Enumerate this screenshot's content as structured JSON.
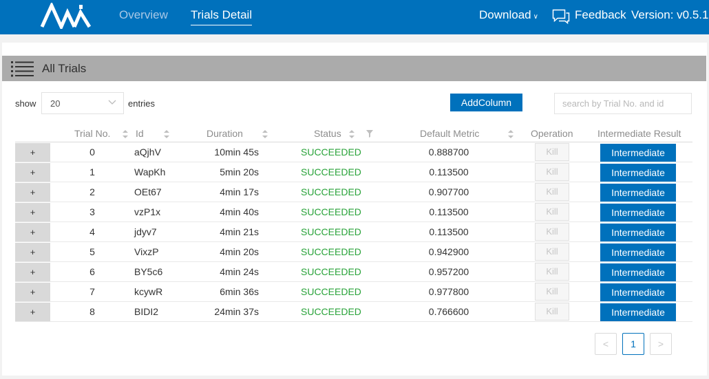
{
  "header": {
    "nav": {
      "overview": "Overview",
      "trials_detail": "Trials Detail"
    },
    "download": "Download",
    "download_caret": "∨",
    "feedback": "Feedback",
    "version": "Version: v0.5.1",
    "color": "#0071bc"
  },
  "panel": {
    "title": "All Trials",
    "show_label": "show",
    "page_size": "20",
    "entries_label": "entries",
    "add_column_label": "AddColumn",
    "search": {
      "placeholder": "search by Trial No. and id",
      "value": ""
    }
  },
  "table": {
    "columns": {
      "trial_no": "Trial No.",
      "id": "Id",
      "duration": "Duration",
      "status": "Status",
      "default_metric": "Default Metric",
      "operation": "Operation",
      "intermediate_result": "Intermediate Result"
    },
    "expand_label": "+",
    "kill_label": "Kill",
    "intermediate_label": "Intermediate",
    "status_color": "#2aa33a",
    "rows": [
      {
        "trial_no": "0",
        "id": "aQjhV",
        "duration": "10min 45s",
        "status": "SUCCEEDED",
        "metric": "0.888700"
      },
      {
        "trial_no": "1",
        "id": "WapKh",
        "duration": "5min 20s",
        "status": "SUCCEEDED",
        "metric": "0.113500"
      },
      {
        "trial_no": "2",
        "id": "OEt67",
        "duration": "4min 17s",
        "status": "SUCCEEDED",
        "metric": "0.907700"
      },
      {
        "trial_no": "3",
        "id": "vzP1x",
        "duration": "4min 40s",
        "status": "SUCCEEDED",
        "metric": "0.113500"
      },
      {
        "trial_no": "4",
        "id": "jdyv7",
        "duration": "4min 21s",
        "status": "SUCCEEDED",
        "metric": "0.113500"
      },
      {
        "trial_no": "5",
        "id": "VixzP",
        "duration": "4min 20s",
        "status": "SUCCEEDED",
        "metric": "0.942900"
      },
      {
        "trial_no": "6",
        "id": "BY5c6",
        "duration": "4min 24s",
        "status": "SUCCEEDED",
        "metric": "0.957200"
      },
      {
        "trial_no": "7",
        "id": "kcywR",
        "duration": "6min 36s",
        "status": "SUCCEEDED",
        "metric": "0.977800"
      },
      {
        "trial_no": "8",
        "id": "BIDI2",
        "duration": "24min 37s",
        "status": "SUCCEEDED",
        "metric": "0.766600"
      }
    ]
  },
  "pagination": {
    "prev": "<",
    "current": "1",
    "next": ">"
  }
}
